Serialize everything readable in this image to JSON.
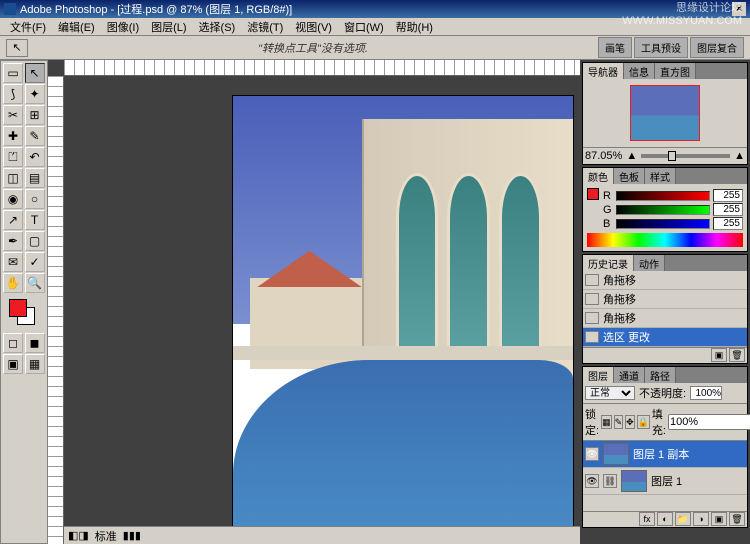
{
  "title": "Adobe Photoshop - [过程.psd @ 87% (图层 1, RGB/8#)]",
  "watermark": {
    "line1": "思缘设计论坛",
    "line2": "WWW.MISSYUAN.COM"
  },
  "menu": {
    "file": "文件(F)",
    "edit": "编辑(E)",
    "image": "图像(I)",
    "layer": "图层(L)",
    "select": "选择(S)",
    "filter": "滤镜(T)",
    "view": "视图(V)",
    "window": "窗口(W)",
    "help": "帮助(H)"
  },
  "options": {
    "hint": "\"转换点工具\"没有选项.",
    "tabs": {
      "brushes": "画笔",
      "toolpresets": "工具预设",
      "layercomps": "图层复合"
    }
  },
  "status": {
    "label": "标准"
  },
  "nav": {
    "tabs": {
      "navigator": "导航器",
      "info": "信息",
      "histogram": "直方图"
    },
    "zoom": "87.05%"
  },
  "color": {
    "tabs": {
      "color": "颜色",
      "swatches": "色板",
      "styles": "样式"
    },
    "r_lbl": "R",
    "g_lbl": "G",
    "b_lbl": "B",
    "r": "255",
    "g": "255",
    "b": "255"
  },
  "history": {
    "tabs": {
      "history": "历史记录",
      "actions": "动作"
    },
    "items": [
      "角拖移",
      "角拖移",
      "角拖移",
      "选区 更改"
    ]
  },
  "layers": {
    "tabs": {
      "layers": "图层",
      "channels": "通道",
      "paths": "路径"
    },
    "blend": "正常",
    "opacity_lbl": "不透明度:",
    "opacity": "100%",
    "lock_lbl": "锁定:",
    "fill_lbl": "填充:",
    "fill": "100%",
    "items": [
      {
        "name": "图层 1 副本"
      },
      {
        "name": "图层 1"
      }
    ]
  }
}
